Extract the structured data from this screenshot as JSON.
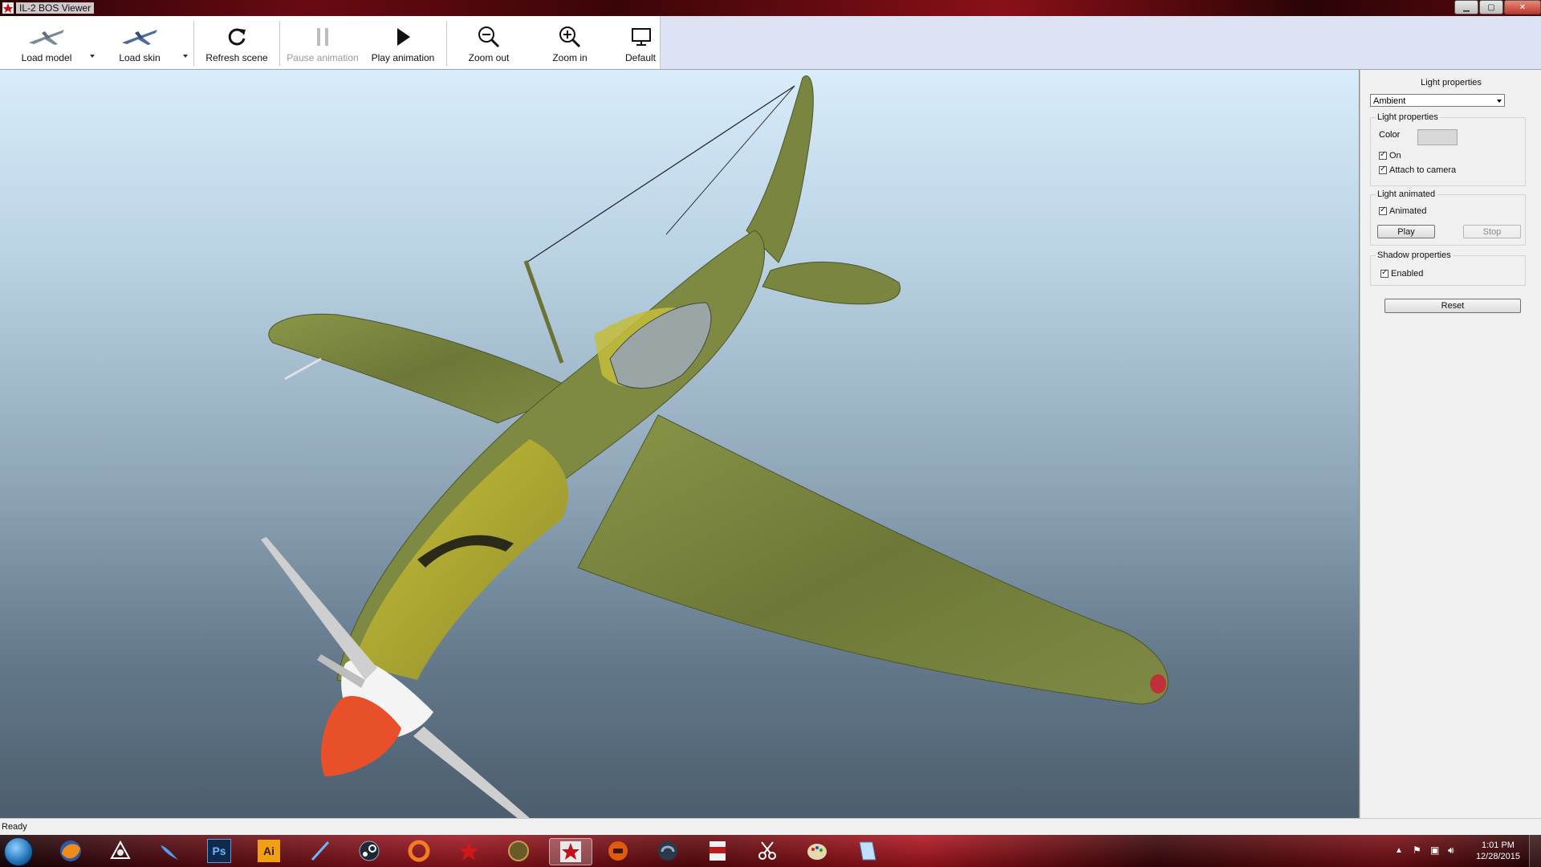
{
  "window": {
    "title": "IL-2 BOS Viewer"
  },
  "toolbar": {
    "load_model": "Load model",
    "load_skin": "Load skin",
    "refresh_scene": "Refresh scene",
    "pause_animation": "Pause animation",
    "play_animation": "Play animation",
    "zoom_out": "Zoom out",
    "zoom_in": "Zoom in",
    "default": "Default"
  },
  "panel": {
    "title": "Light properties",
    "light_select": "Ambient",
    "light_group": {
      "title": "Light properties",
      "color_label": "Color",
      "color_value": "#d8d8d8",
      "on_label": "On",
      "on_checked": true,
      "attach_label": "Attach to camera",
      "attach_checked": true
    },
    "animated_group": {
      "title": "Light animated",
      "animated_label": "Animated",
      "animated_checked": true,
      "play": "Play",
      "stop": "Stop"
    },
    "shadow_group": {
      "title": "Shadow properties",
      "enabled_label": "Enabled",
      "enabled_checked": true
    },
    "reset": "Reset"
  },
  "status": {
    "text": "Ready"
  },
  "taskbar": {
    "apps": [
      "firefox-icon",
      "3d-app-icon",
      "bird-app-icon",
      "photoshop-icon",
      "illustrator-icon",
      "pen-app-icon",
      "steam-icon",
      "origin-icon",
      "red-star-icon",
      "medal-app-icon",
      "il2-viewer-icon",
      "helmet-app-icon",
      "headset-app-icon",
      "pdf-app-icon",
      "scissors-app-icon",
      "paint-app-icon",
      "notepad-app-icon"
    ],
    "photoshop_label": "Ps",
    "illustrator_label": "Ai",
    "time": "1:01 PM",
    "date": "12/28/2015"
  }
}
